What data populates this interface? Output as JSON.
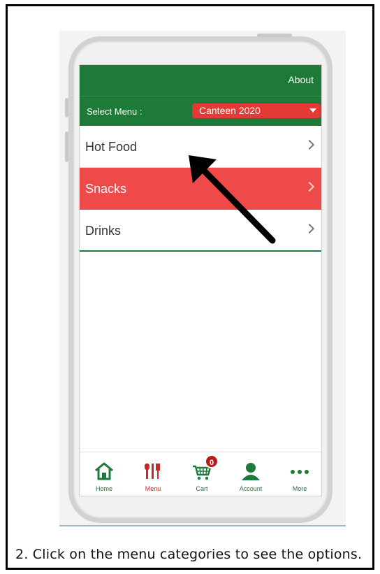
{
  "header": {
    "about_label": "About"
  },
  "select_menu": {
    "label": "Select Menu :",
    "value": "Canteen 2020"
  },
  "menu_items": [
    {
      "label": "Hot Food"
    },
    {
      "label": "Snacks"
    },
    {
      "label": "Drinks"
    }
  ],
  "tabbar": {
    "home": "Home",
    "menu": "Menu",
    "cart": "Cart",
    "cart_count": "0",
    "account": "Account",
    "more": "More"
  },
  "caption": "2. Click on the menu categories to see the options.",
  "colors": {
    "brand_green": "#1e7a38",
    "accent_red": "#ef4a4a",
    "select_red": "#e53935"
  }
}
